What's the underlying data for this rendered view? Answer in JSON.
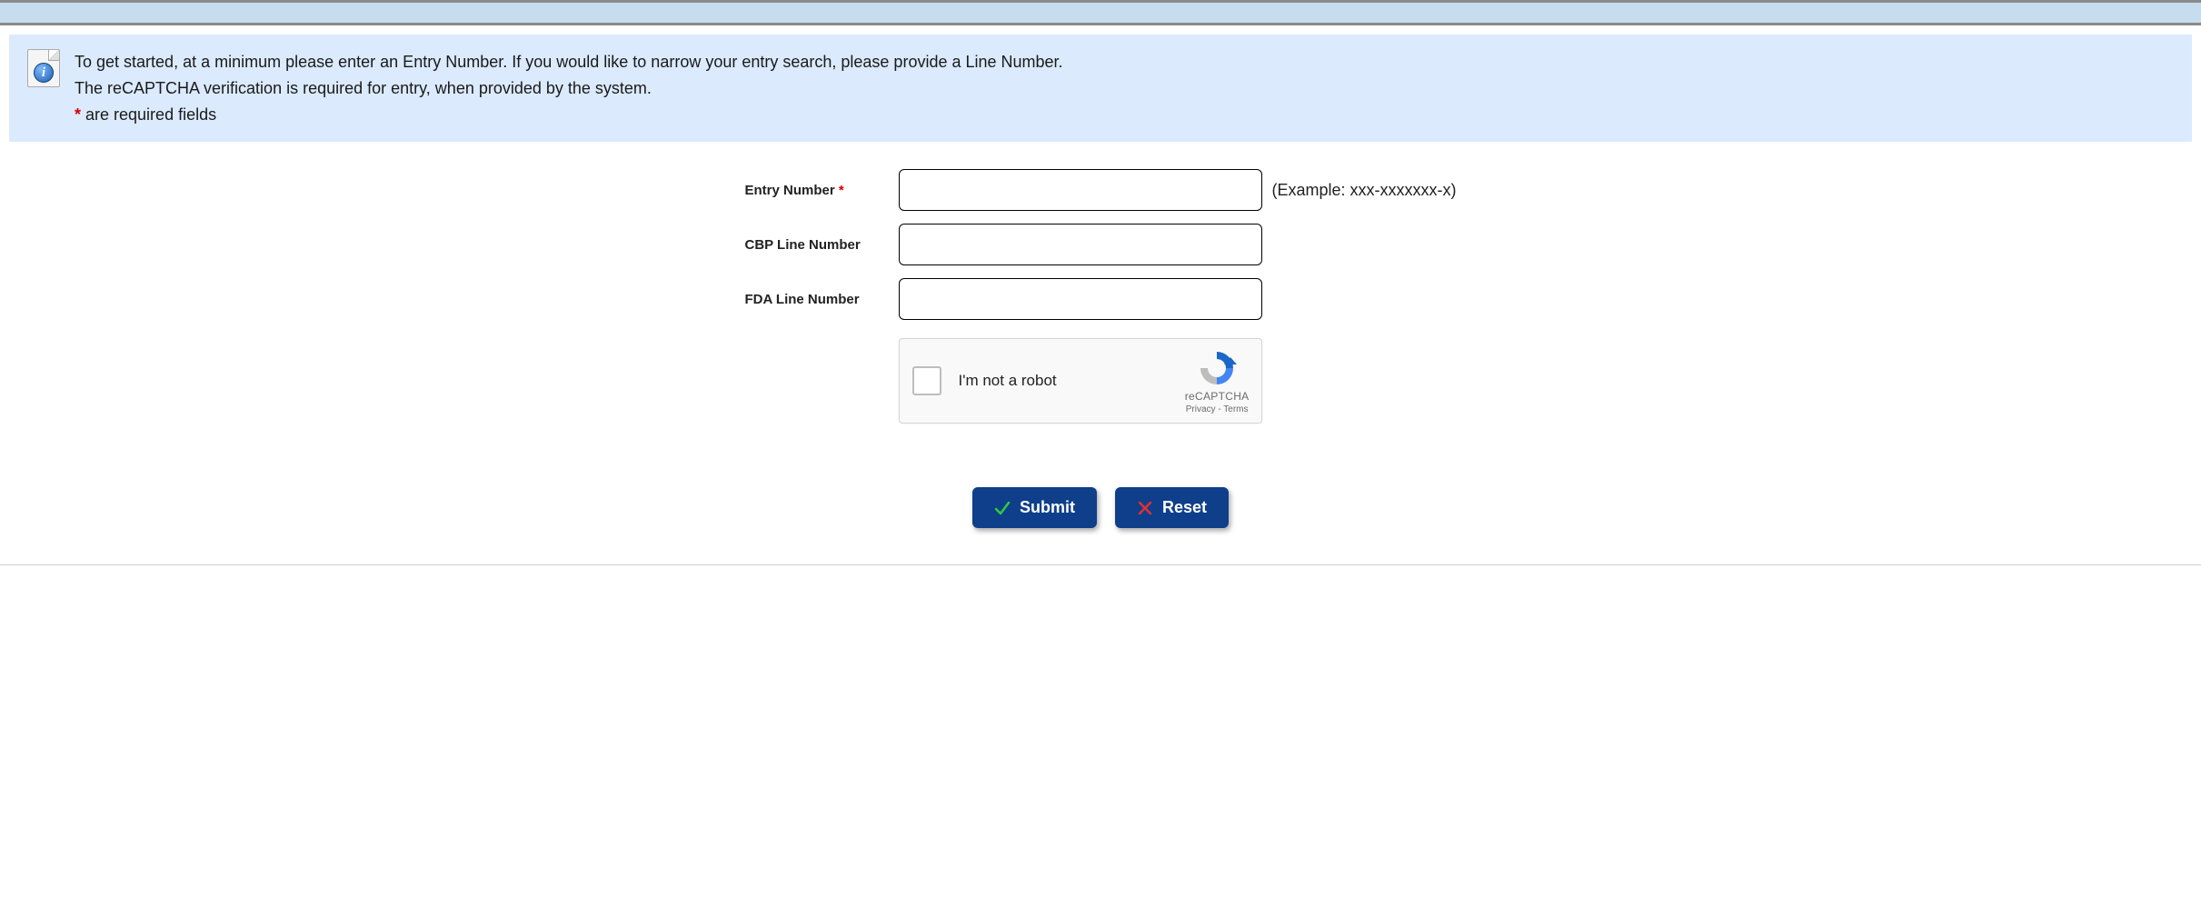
{
  "info": {
    "line1": "To get started, at a minimum please enter an Entry Number. If you would like to narrow your entry search, please provide a Line Number.",
    "line2": "The reCAPTCHA verification is required for entry, when provided by the system.",
    "required_marker": "*",
    "required_text": " are required fields"
  },
  "form": {
    "entry_number": {
      "label": "Entry Number",
      "required_marker": "*",
      "value": "",
      "hint": "(Example: xxx-xxxxxxx-x)"
    },
    "cbp_line_number": {
      "label": "CBP Line Number",
      "value": ""
    },
    "fda_line_number": {
      "label": "FDA Line Number",
      "value": ""
    }
  },
  "recaptcha": {
    "label": "I'm not a robot",
    "brand": "reCAPTCHA",
    "privacy": "Privacy",
    "sep": " - ",
    "terms": "Terms"
  },
  "buttons": {
    "submit": "Submit",
    "reset": "Reset"
  }
}
